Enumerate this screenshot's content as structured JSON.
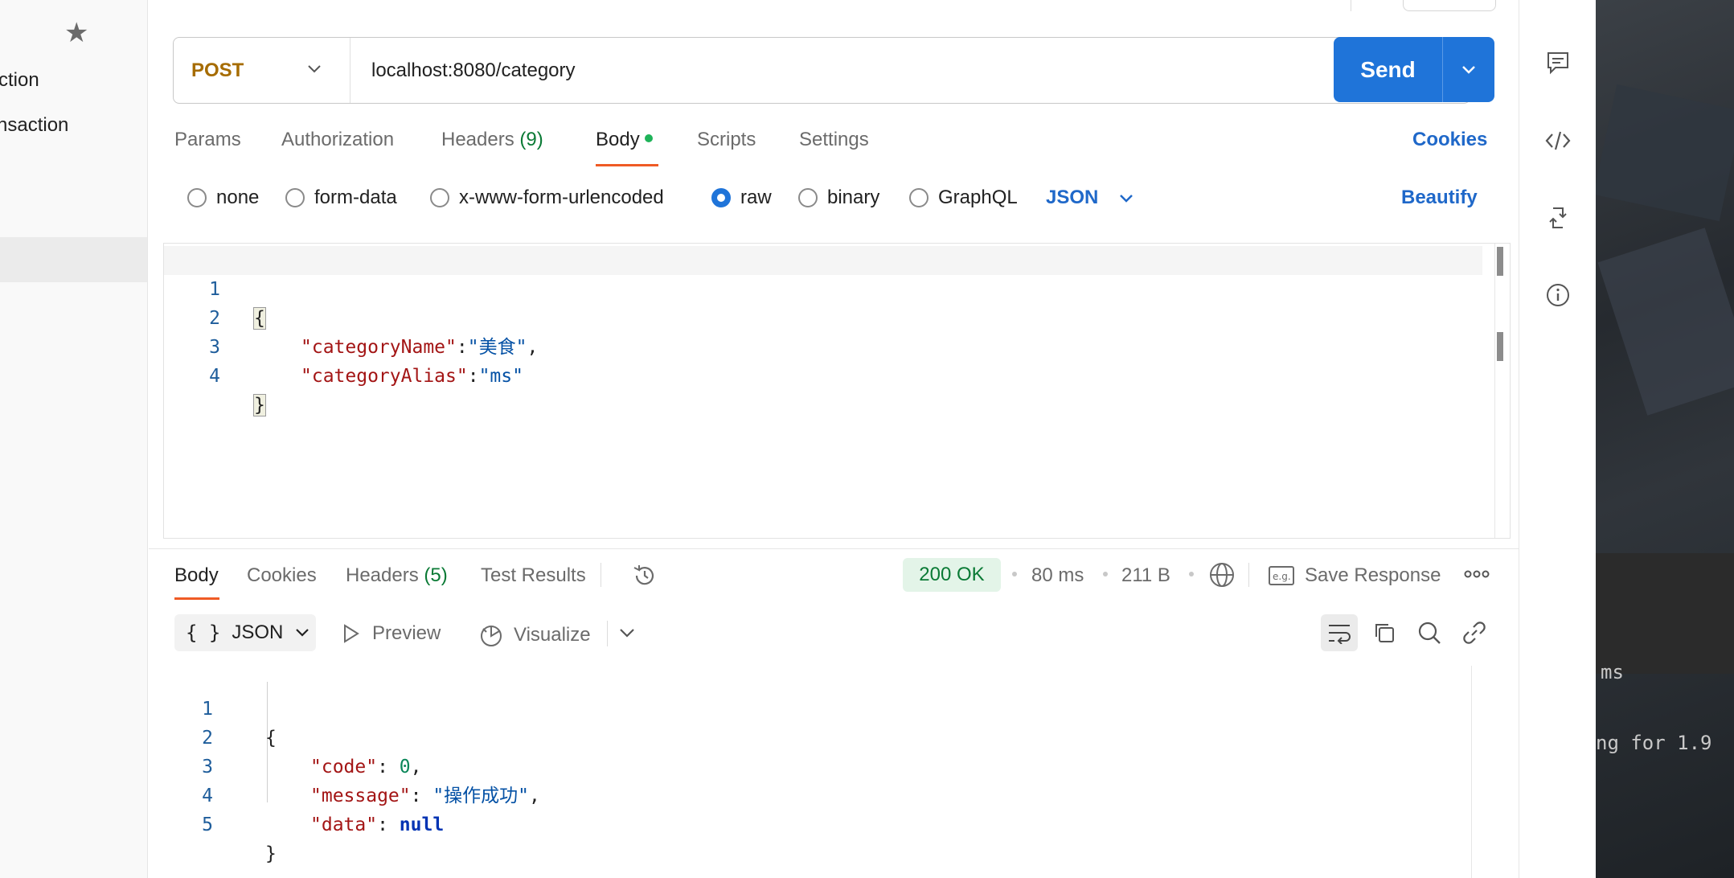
{
  "sidebar": {
    "items": [
      {
        "label": "ction"
      },
      {
        "label": "nsaction"
      }
    ]
  },
  "request": {
    "method": "POST",
    "url": "localhost:8080/category",
    "send_label": "Send"
  },
  "request_tabs": {
    "params": "Params",
    "authorization": "Authorization",
    "headers": "Headers",
    "headers_count": "(9)",
    "body": "Body",
    "scripts": "Scripts",
    "settings": "Settings",
    "cookies": "Cookies"
  },
  "body_types": {
    "none": "none",
    "form_data": "form-data",
    "urlencoded": "x-www-form-urlencoded",
    "raw": "raw",
    "binary": "binary",
    "graphql": "GraphQL",
    "selected": "raw",
    "language": "JSON",
    "beautify": "Beautify"
  },
  "request_body": {
    "line_numbers": [
      "1",
      "2",
      "3",
      "4"
    ],
    "key1": "\"categoryName\"",
    "val1": "\"美食\"",
    "key2": "\"categoryAlias\"",
    "val2": "\"ms\""
  },
  "response_tabs": {
    "body": "Body",
    "cookies": "Cookies",
    "headers": "Headers",
    "headers_count": "(5)",
    "test_results": "Test Results"
  },
  "response_meta": {
    "status": "200 OK",
    "time": "80 ms",
    "size": "211 B",
    "save_response": "Save Response"
  },
  "response_toolbar": {
    "format": "JSON",
    "preview": "Preview",
    "visualize": "Visualize"
  },
  "response_body": {
    "line_numbers": [
      "1",
      "2",
      "3",
      "4",
      "5"
    ],
    "key_code": "\"code\"",
    "val_code": "0",
    "key_message": "\"message\"",
    "val_message": "\"操作成功\"",
    "key_data": "\"data\"",
    "val_data": "null"
  },
  "background_terminal": {
    "line1": "ms",
    "line2": "ng for 1.9"
  },
  "colors": {
    "accent": "#1f74d9",
    "method_post": "#a66c00",
    "status_ok": "#0a7a35",
    "tab_indicator": "#ef5b25"
  }
}
